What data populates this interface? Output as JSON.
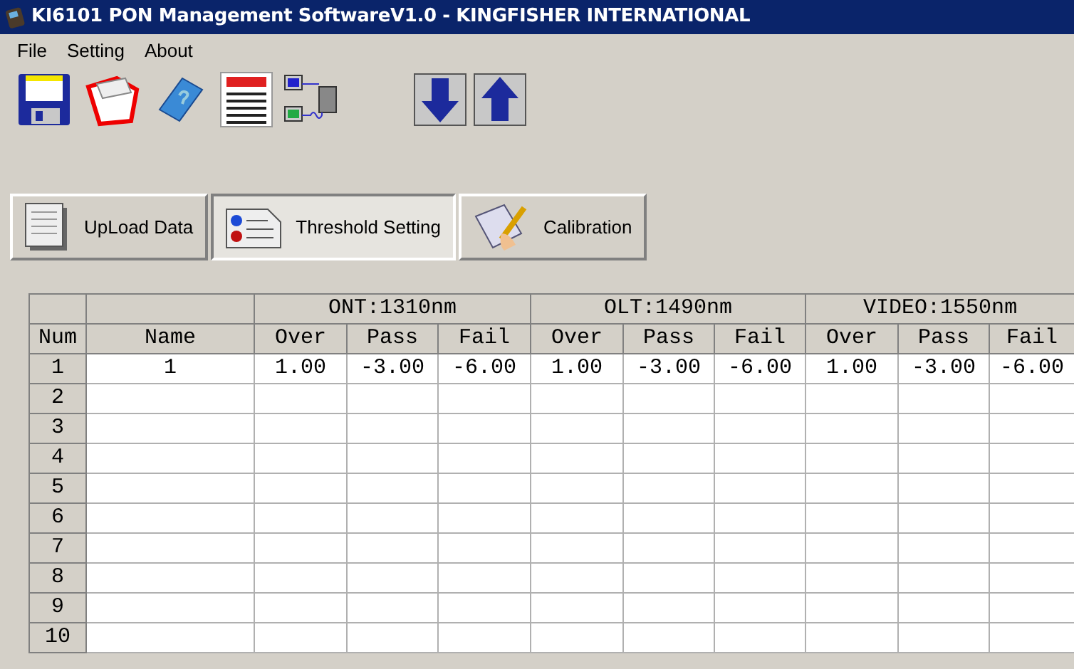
{
  "window": {
    "title": "KI6101 PON Management SoftwareV1.0 - KINGFISHER INTERNATIONAL"
  },
  "menu": [
    "File",
    "Setting",
    "About"
  ],
  "tabs": [
    {
      "label": "UpLoad Data",
      "selected": false
    },
    {
      "label": "Threshold Setting",
      "selected": true
    },
    {
      "label": "Calibration",
      "selected": false
    }
  ],
  "table": {
    "groups": [
      "ONT:1310nm",
      "OLT:1490nm",
      "VIDEO:1550nm"
    ],
    "columns": [
      "Num",
      "Name",
      "Over",
      "Pass",
      "Fail",
      "Over",
      "Pass",
      "Fail",
      "Over",
      "Pass",
      "Fail"
    ],
    "rows": [
      [
        "1",
        "1",
        "1.00",
        "-3.00",
        "-6.00",
        "1.00",
        "-3.00",
        "-6.00",
        "1.00",
        "-3.00",
        "-6.00"
      ],
      [
        "2"
      ],
      [
        "3"
      ],
      [
        "4"
      ],
      [
        "5"
      ],
      [
        "6"
      ],
      [
        "7"
      ],
      [
        "8"
      ],
      [
        "9"
      ],
      [
        "10"
      ]
    ]
  }
}
